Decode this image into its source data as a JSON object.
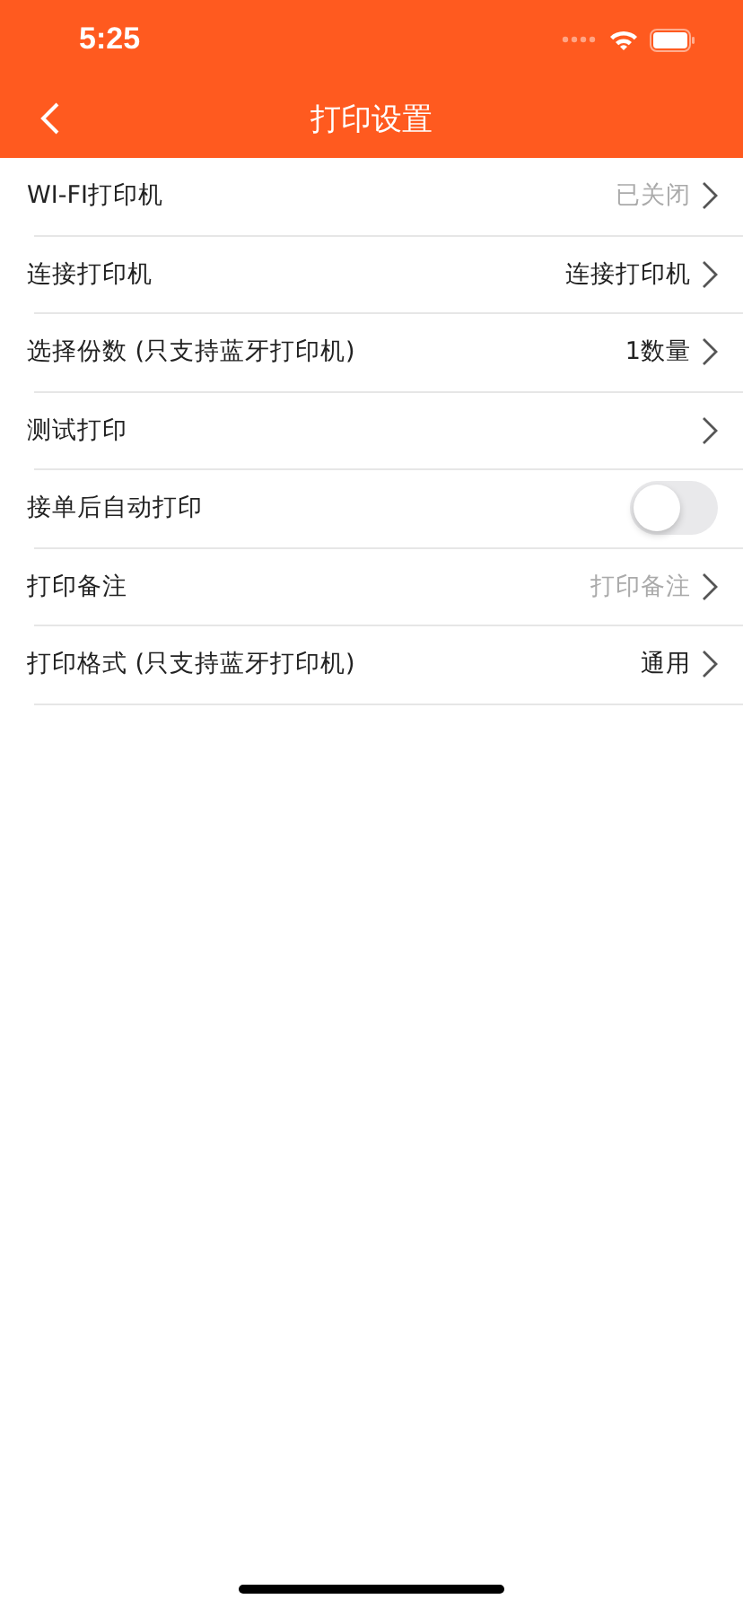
{
  "status_bar": {
    "time": "5:25"
  },
  "nav": {
    "title": "打印设置"
  },
  "rows": [
    {
      "kind": "link",
      "label": "WI-FI打印机",
      "value": "已关闭",
      "muted": true
    },
    {
      "kind": "link",
      "label": "连接打印机",
      "value": "连接打印机",
      "muted": false
    },
    {
      "kind": "link",
      "label": "选择份数 (只支持蓝牙打印机)",
      "value": "1数量",
      "muted": false
    },
    {
      "kind": "link",
      "label": "测试打印"
    },
    {
      "kind": "toggle",
      "label": "接单后自动打印",
      "on": false
    },
    {
      "kind": "link",
      "label": "打印备注",
      "value": "打印备注",
      "muted": true
    },
    {
      "kind": "link",
      "label": "打印格式 (只支持蓝牙打印机)",
      "value": "通用",
      "muted": false
    }
  ]
}
